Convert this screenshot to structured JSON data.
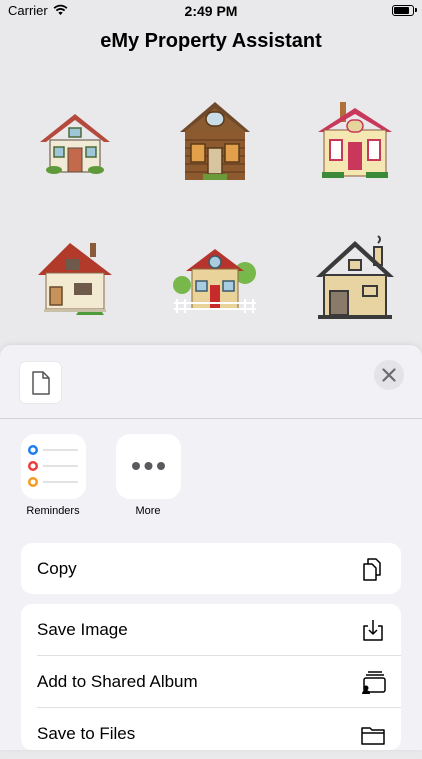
{
  "status": {
    "carrier": "Carrier",
    "time": "2:49 PM"
  },
  "app": {
    "title": "eMy Property Assistant"
  },
  "houses": [
    {
      "icon": "cottage-house-icon"
    },
    {
      "icon": "log-cabin-house-icon"
    },
    {
      "icon": "victorian-house-icon"
    },
    {
      "icon": "red-roof-house-icon"
    },
    {
      "icon": "garden-house-icon"
    },
    {
      "icon": "outline-house-icon"
    }
  ],
  "share_sheet": {
    "apps": [
      {
        "label": "Reminders"
      },
      {
        "label": "More"
      }
    ],
    "actions": {
      "copy": "Copy",
      "save_image": "Save Image",
      "add_shared_album": "Add to Shared Album",
      "save_files": "Save to Files"
    }
  }
}
